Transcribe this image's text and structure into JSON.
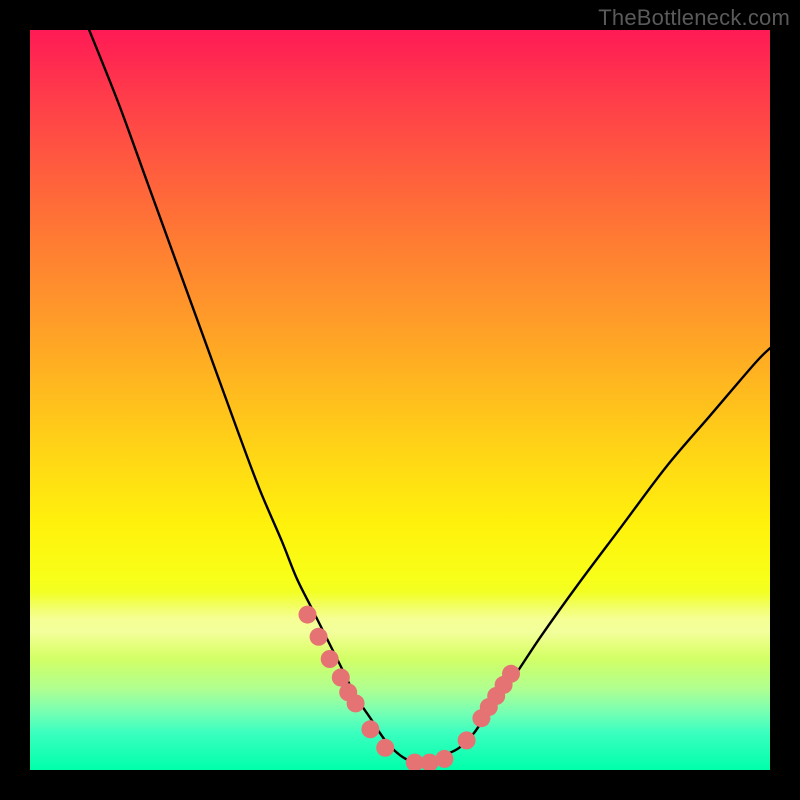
{
  "watermark": "TheBottleneck.com",
  "colors": {
    "curve": "#000000",
    "marker_fill": "#e57373",
    "marker_stroke": "#c15a5a",
    "background_top": "#ff1a55",
    "background_bottom": "#00ffaa",
    "page_bg": "#000000"
  },
  "chart_data": {
    "type": "line",
    "title": "",
    "xlabel": "",
    "ylabel": "",
    "xlim": [
      0,
      100
    ],
    "ylim": [
      0,
      100
    ],
    "grid": false,
    "legend": false,
    "series": [
      {
        "name": "bottleneck-curve",
        "x": [
          8,
          12,
          16,
          20,
          24,
          28,
          31,
          34,
          36,
          38,
          40,
          42,
          44,
          46,
          48,
          50,
          52,
          54,
          56,
          58,
          60,
          62,
          65,
          69,
          74,
          80,
          86,
          92,
          98,
          100
        ],
        "y": [
          100,
          90,
          79,
          68,
          57,
          46,
          38,
          31,
          26,
          22,
          18,
          14,
          10,
          7,
          4,
          2,
          1,
          1,
          2,
          3,
          5,
          8,
          12,
          18,
          25,
          33,
          41,
          48,
          55,
          57
        ]
      }
    ],
    "markers": {
      "name": "highlight-points",
      "x": [
        37.5,
        39.0,
        40.5,
        42.0,
        43.0,
        44.0,
        46.0,
        48.0,
        52.0,
        54.0,
        56.0,
        59.0,
        61.0,
        62.0,
        63.0,
        64.0,
        65.0
      ],
      "y": [
        21.0,
        18.0,
        15.0,
        12.5,
        10.5,
        9.0,
        5.5,
        3.0,
        1.0,
        1.0,
        1.5,
        4.0,
        7.0,
        8.5,
        10.0,
        11.5,
        13.0
      ]
    }
  }
}
